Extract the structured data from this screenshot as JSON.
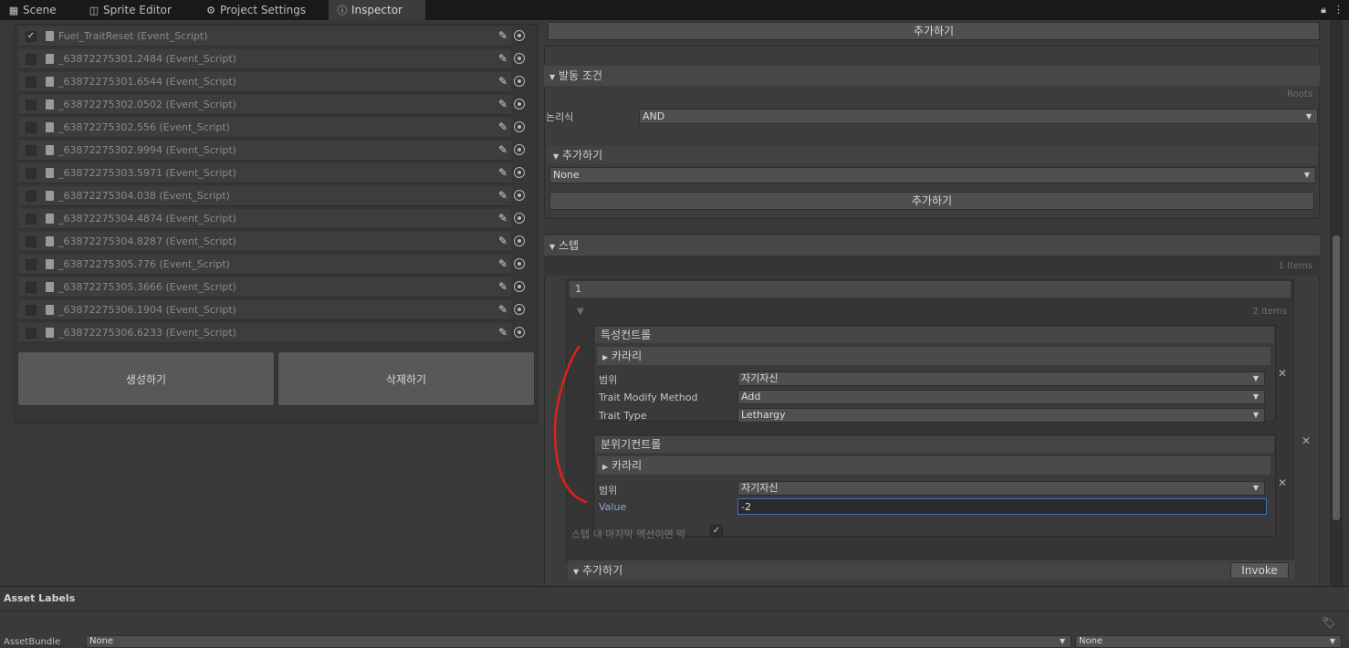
{
  "tabs": [
    {
      "label": "Scene",
      "icon": "grid-icon"
    },
    {
      "label": "Sprite Editor",
      "icon": "sprite-editor-icon"
    },
    {
      "label": "Project Settings",
      "icon": "gear-icon"
    },
    {
      "label": "Inspector",
      "icon": "info-icon"
    }
  ],
  "event_list": {
    "items": [
      {
        "label": "Fuel_TraitReset (Event_Script)",
        "checked": true
      },
      {
        "label": "_63872275301.2484 (Event_Script)",
        "checked": false
      },
      {
        "label": "_63872275301.6544 (Event_Script)",
        "checked": false
      },
      {
        "label": "_63872275302.0502 (Event_Script)",
        "checked": false
      },
      {
        "label": "_63872275302.556 (Event_Script)",
        "checked": false
      },
      {
        "label": "_63872275302.9994 (Event_Script)",
        "checked": false
      },
      {
        "label": "_63872275303.5971 (Event_Script)",
        "checked": false
      },
      {
        "label": "_63872275304.038 (Event_Script)",
        "checked": false
      },
      {
        "label": "_63872275304.4874 (Event_Script)",
        "checked": false
      },
      {
        "label": "_63872275304.8287 (Event_Script)",
        "checked": false
      },
      {
        "label": "_63872275305.776 (Event_Script)",
        "checked": false
      },
      {
        "label": "_63872275305.3666 (Event_Script)",
        "checked": false
      },
      {
        "label": "_63872275306.1904 (Event_Script)",
        "checked": false
      },
      {
        "label": "_63872275306.6233 (Event_Script)",
        "checked": false
      }
    ],
    "create_button": "생성하기",
    "delete_button": "삭제하기"
  },
  "inspector": {
    "top_add_button": "추가하기",
    "trigger_condition": {
      "header": "발동 조건",
      "roots_label": "Roots",
      "logic_label": "논리식",
      "logic_value": "AND",
      "add_header": "추가하기",
      "add_dropdown_value": "None",
      "add_button": "추가하기"
    },
    "steps": {
      "header": "스텝",
      "count_label": "1 Items",
      "element_index": "1",
      "element_count_label": "2 Items",
      "trait_control": {
        "header": "특성컨트롤",
        "character_foldout": "카라리",
        "range_label": "범위",
        "range_value": "자기자신",
        "method_label": "Trait Modify Method",
        "method_value": "Add",
        "type_label": "Trait Type",
        "type_value": "Lethargy"
      },
      "mood_control": {
        "header": "분위기컨트롤",
        "character_foldout": "카라리",
        "range_label": "범위",
        "range_value": "자기자신",
        "value_label": "Value",
        "value_value": "-2"
      },
      "last_action_label": "스텝 내 마지막 액션이면 막",
      "last_action_checked": true,
      "add_header": "추가하기",
      "invoke_button": "Invoke"
    }
  },
  "asset_labels": {
    "title": "Asset Labels",
    "bundle_label": "AssetBundle",
    "bundle_value": "None",
    "variant_value": "None"
  },
  "annotation_color": "#e0201c"
}
